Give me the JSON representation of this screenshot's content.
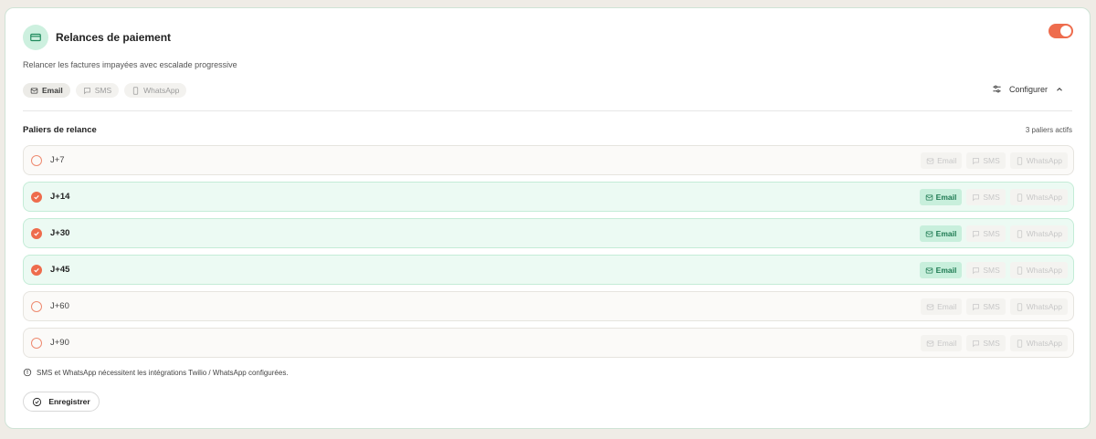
{
  "header": {
    "title": "Relances de paiement",
    "subtitle": "Relancer les factures impayées avec escalade progressive",
    "enabled": true,
    "accent_color": "#ee6c4d",
    "icon": "credit-card-icon"
  },
  "channels": [
    {
      "label": "Email",
      "icon": "mail-icon",
      "active": true
    },
    {
      "label": "SMS",
      "icon": "message-icon",
      "active": false
    },
    {
      "label": "WhatsApp",
      "icon": "phone-icon",
      "active": false
    }
  ],
  "configure": {
    "label": "Configurer",
    "icon": "sliders-icon"
  },
  "tiers_section": {
    "title": "Paliers de relance",
    "count_label": "3 paliers actifs"
  },
  "tiers": [
    {
      "label": "J+7",
      "active": false,
      "email_label": "Email",
      "sms_label": "SMS",
      "whatsapp_label": "WhatsApp"
    },
    {
      "label": "J+14",
      "active": true,
      "email_label": "Email",
      "sms_label": "SMS",
      "whatsapp_label": "WhatsApp"
    },
    {
      "label": "J+30",
      "active": true,
      "email_label": "Email",
      "sms_label": "SMS",
      "whatsapp_label": "WhatsApp"
    },
    {
      "label": "J+45",
      "active": true,
      "email_label": "Email",
      "sms_label": "SMS",
      "whatsapp_label": "WhatsApp"
    },
    {
      "label": "J+60",
      "active": false,
      "email_label": "Email",
      "sms_label": "SMS",
      "whatsapp_label": "WhatsApp"
    },
    {
      "label": "J+90",
      "active": false,
      "email_label": "Email",
      "sms_label": "SMS",
      "whatsapp_label": "WhatsApp"
    }
  ],
  "note": "SMS et WhatsApp nécessitent les intégrations Twilio / WhatsApp configurées.",
  "save_label": "Enregistrer"
}
